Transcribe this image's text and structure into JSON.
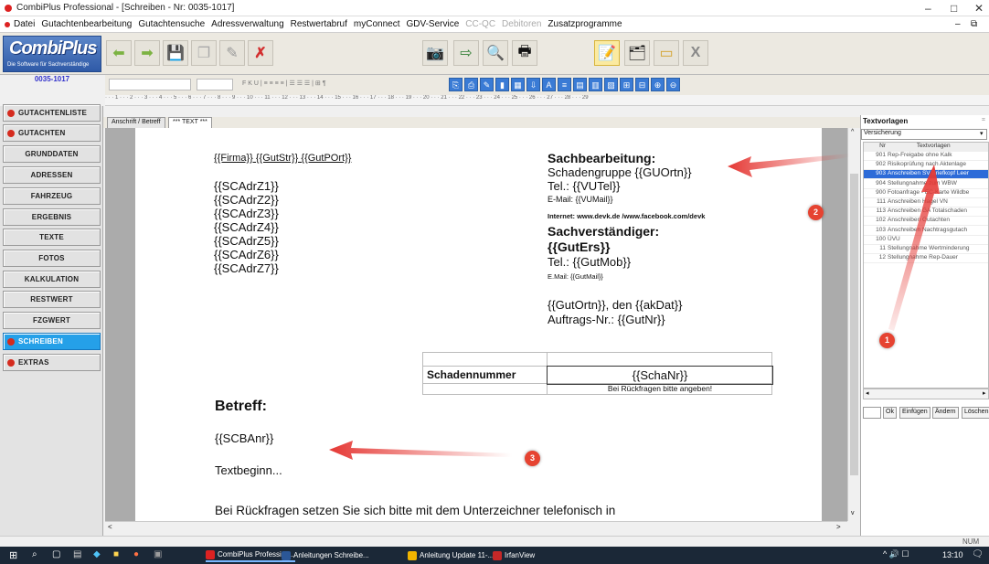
{
  "window": {
    "title": "CombiPlus Professional - [Schreiben - Nr: 0035-1017]",
    "minimize": "–",
    "maximize": "□",
    "close": "✕",
    "inner_min": "–",
    "inner_restore": "⧉"
  },
  "menu": {
    "items": [
      "Datei",
      "Gutachtenbearbeitung",
      "Gutachtensuche",
      "Adressverwaltung",
      "Restwertabruf",
      "myConnect",
      "GDV-Service"
    ],
    "disabled": [
      "CC-QC",
      "Debitoren"
    ],
    "last": "Zusatzprogramme"
  },
  "logo": {
    "name": "CombiPlus",
    "tagline": "Die Software für Sachverständige",
    "doc_number": "0035-1017"
  },
  "format_bar": {
    "style_buttons": "F  K  U  |  ≡  ≡  ≡  ≡  |  ☰  ☰  ☰  |  ⊞  ¶"
  },
  "ruler": "· · · 1 · · · 2 · · · 3 · · · 4 · · · 5 · · · 6 · · · 7 · · · 8 · · · 9 · · · 10 · · · 11 · · · 12 · · · 13 · · · 14 · · · 15 · · · 16 · · · 17 · · · 18 · · · 19 · · · 20 · · · 21 · · · 22 · · · 23 · · · 24 · · · 25 · · · 26 · · · 27 · · · 28 · · · 29",
  "sidebar": {
    "items": [
      {
        "label": "GUTACHTENLISTE",
        "red": true
      },
      {
        "label": "GUTACHTEN",
        "red": true
      },
      {
        "label": "GRUNDDATEN",
        "red": false
      },
      {
        "label": "ADRESSEN",
        "red": false
      },
      {
        "label": "FAHRZEUG",
        "red": false
      },
      {
        "label": "ERGEBNIS",
        "red": false
      },
      {
        "label": "TEXTE",
        "red": false
      },
      {
        "label": "FOTOS",
        "red": false
      },
      {
        "label": "KALKULATION",
        "red": false
      },
      {
        "label": "RESTWERT",
        "red": false
      },
      {
        "label": "FZGWERT",
        "red": false
      },
      {
        "label": "SCHREIBEN",
        "red": true,
        "active": true
      },
      {
        "label": "EXTRAS",
        "red": true
      }
    ]
  },
  "tabs": [
    "Anschrift / Betreff",
    "*** TEXT ***"
  ],
  "document": {
    "sender_line": "{{Firma}} {{GutStr}} {{GutPOrt}}",
    "address_lines": [
      "{{SCAdrZ1}}",
      "{{SCAdrZ2}}",
      "{{SCAdrZ3}}",
      "{{SCAdrZ4}}",
      "{{SCAdrZ5}}",
      "{{SCAdrZ6}}",
      "{{SCAdrZ7}}"
    ],
    "sachbearbeitung_label": "Sachbearbeitung:",
    "schadengruppe": "Schadengruppe {{GUOrtn}}",
    "tel1": "Tel.: {{VUTel}}",
    "email1": "E-Mail: {{VUMail}}",
    "internet": "Internet: www.devk.de /www.facebook.com/devk",
    "sachverstaendiger_label": "Sachverständiger:",
    "gutachter": "{{GutErs}}",
    "tel2": "Tel.: {{GutMob}}",
    "email2": "E.Mail: {{GutMail}}",
    "ort_datum": "{{GutOrtn}}, den  {{akDat}}",
    "auftrags_nr": "Auftrags-Nr.: {{GutNr}}",
    "schadennummer_label": "Schadennummer",
    "schadennummer_value": "{{SchaNr}}",
    "rueckfragen_hint": "Bei Rückfragen bitte angeben!",
    "betreff_label": "Betreff:",
    "betreff_value": "{{SCBAnr}}",
    "textbeginn": "Textbeginn...",
    "closing_line": "Bei Rückfragen setzen Sie sich bitte mit dem Unterzeichner telefonisch in"
  },
  "right_panel": {
    "title": "Textvorlagen",
    "pin": "⌗",
    "select_value": "Versicherung",
    "col_nr": "Nr",
    "col_name": "Textvorlagen",
    "rows": [
      {
        "nr": "901",
        "name": "Rep-Freigabe ohne Kalk"
      },
      {
        "nr": "902",
        "name": "Risikoprüfung nach Aktenlage"
      },
      {
        "nr": "903",
        "name": "Anschreiben SV Briefkopf Leer",
        "selected": true
      },
      {
        "nr": "904",
        "name": "Stellungnahme zum WBW"
      },
      {
        "nr": "900",
        "name": "Fotoanfrage - EC-Karte Wildbe"
      },
      {
        "nr": "111",
        "name": "Anschreiben Hagel VN"
      },
      {
        "nr": "113",
        "name": "Anschreiben GA Totalschaden"
      },
      {
        "nr": "102",
        "name": "Anschreiben Gutachten"
      },
      {
        "nr": "103",
        "name": "Anschreiben Nachtragsgutach"
      },
      {
        "nr": "100",
        "name": "ÜVU"
      },
      {
        "nr": "11",
        "name": "Stellungnahme Wertminderung"
      },
      {
        "nr": "12",
        "name": "Stellungnahme Rep-Dauer"
      }
    ],
    "buttons": {
      "ok": "Ok",
      "insert": "Einfügen",
      "change": "Ändern",
      "delete": "Löschen"
    }
  },
  "statusbar": {
    "num": "NUM"
  },
  "taskbar": {
    "tasks": [
      {
        "label": "CombiPlus Profession...",
        "color": "#d22"
      },
      {
        "label": "Anleitungen Schreibe...",
        "color": "#2b5797"
      },
      {
        "label": "Anleitung Update 11-...",
        "color": "#f0b400"
      },
      {
        "label": "IrfanView",
        "color": "#c62828"
      }
    ],
    "time": "13:10",
    "tray": "^ 🔊 ☐"
  },
  "annotations": {
    "badge1": "1",
    "badge2": "2",
    "badge3": "3",
    "arrow_color": "#e53935"
  }
}
